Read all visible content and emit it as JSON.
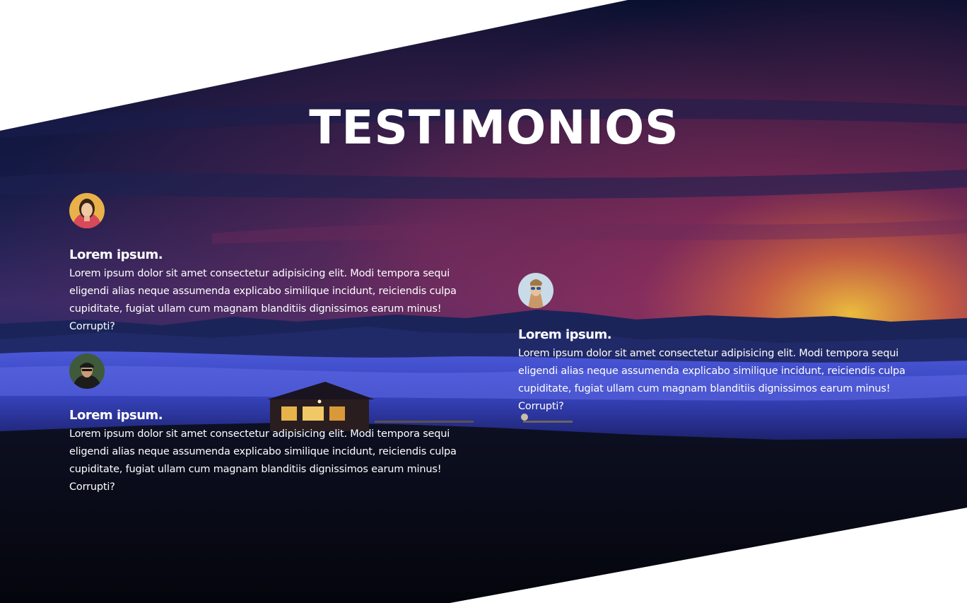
{
  "section": {
    "title": "TESTIMONIOS"
  },
  "testimonials": [
    {
      "name": "Lorem ipsum.",
      "text": "Lorem ipsum dolor sit amet consectetur adipisicing elit. Modi tempora sequi eligendi alias neque assumenda explicabo similique incidunt, reiciendis culpa cupiditate, fugiat ullam cum magnam blanditiis dignissimos earum minus! Corrupti?",
      "avatar": "woman-portrait-avatar"
    },
    {
      "name": "Lorem ipsum.",
      "text": "Lorem ipsum dolor sit amet consectetur adipisicing elit. Modi tempora sequi eligendi alias neque assumenda explicabo similique incidunt, reiciendis culpa cupiditate, fugiat ullam cum magnam blanditiis dignissimos earum minus! Corrupti?",
      "avatar": "man-portrait-avatar"
    },
    {
      "name": "Lorem ipsum.",
      "text": "Lorem ipsum dolor sit amet consectetur adipisicing elit. Modi tempora sequi eligendi alias neque assumenda explicabo similique incidunt, reiciendis culpa cupiditate, fugiat ullam cum magnam blanditiis dignissimos earum minus! Corrupti?",
      "avatar": "woman-sunglasses-avatar"
    }
  ],
  "colors": {
    "text": "#ffffff",
    "sky_dark": "#0c1330",
    "sunset_red": "#c0344f",
    "sunset_yellow": "#f2c23a",
    "fog_blue": "#3a46c8",
    "page_bg": "#ffffff"
  }
}
